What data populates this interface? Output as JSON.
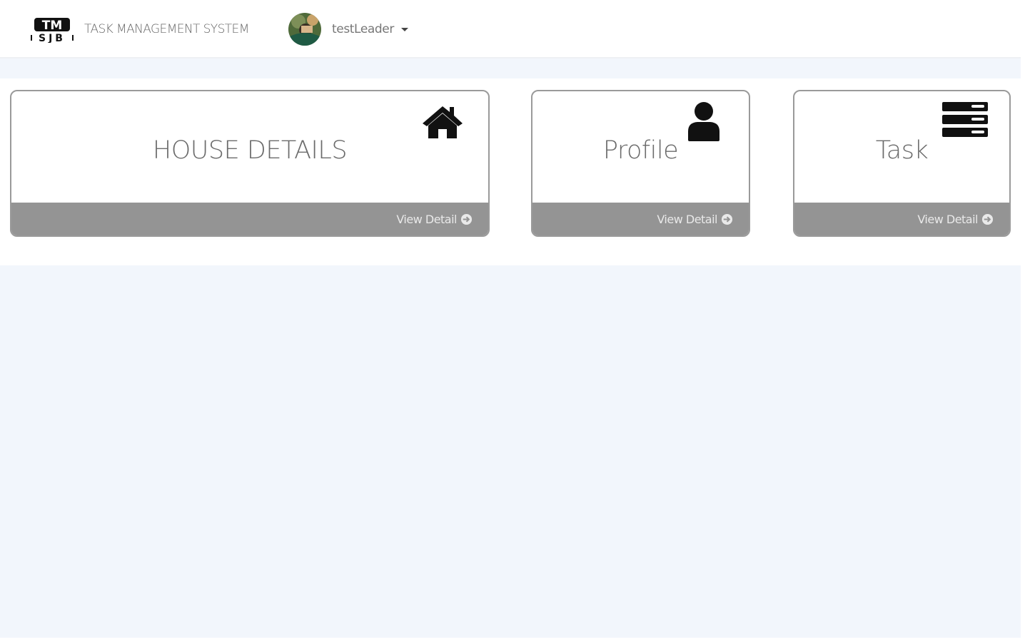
{
  "header": {
    "logo_text_top": "TM",
    "logo_text_bottom": "SJB",
    "app_title": "TASK MANAGEMENT SYSTEM",
    "user": {
      "name": "testLeader",
      "avatar_icon": "user-avatar-photo",
      "menu_icon": "caret-down-icon"
    }
  },
  "cards": [
    {
      "title": "HOUSE DETAILS",
      "icon": "home-icon",
      "link_label": "View Detail",
      "link_icon": "arrow-circle-right-icon"
    },
    {
      "title": "Profile",
      "icon": "user-icon",
      "link_label": "View Detail",
      "link_icon": "arrow-circle-right-icon"
    },
    {
      "title": "Task",
      "icon": "server-icon",
      "link_label": "View Detail",
      "link_icon": "arrow-circle-right-icon"
    }
  ],
  "colors": {
    "page_background": "#f2f6fc",
    "card_footer": "#949494",
    "card_border": "#9a9a9a",
    "title_text": "#6b6b6b"
  }
}
